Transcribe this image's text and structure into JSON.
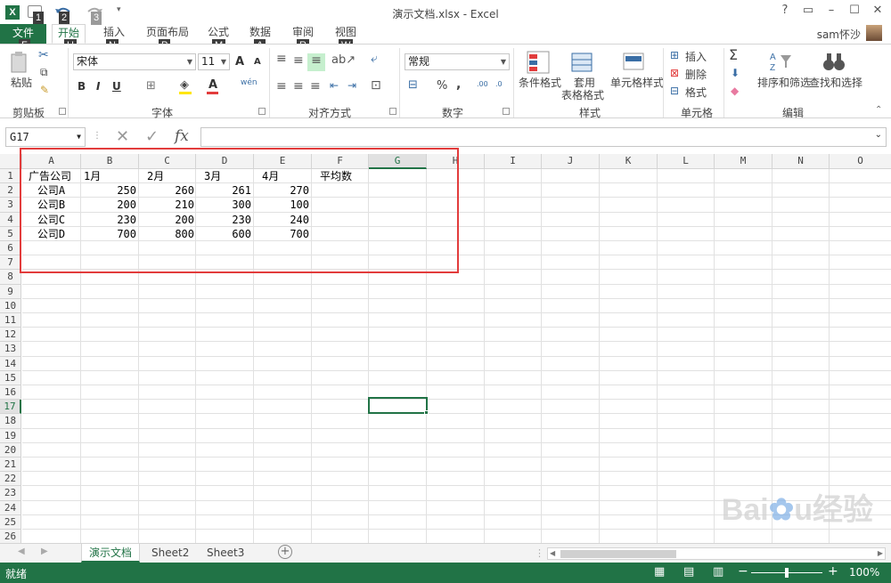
{
  "window": {
    "title": "演示文档.xlsx - Excel",
    "user": "sam怀沙",
    "controls": [
      "?",
      "▭",
      "–",
      "☐",
      "✕"
    ]
  },
  "keytips": {
    "qat": [
      "1",
      "2",
      "3"
    ],
    "tabs": [
      "F",
      "H",
      "N",
      "P",
      "M",
      "A",
      "R",
      "W"
    ]
  },
  "tabs": [
    "文件",
    "开始",
    "插入",
    "页面布局",
    "公式",
    "数据",
    "审阅",
    "视图"
  ],
  "ribbon": {
    "clipboard": {
      "paste": "粘贴",
      "label": "剪贴板"
    },
    "font": {
      "name": "宋体",
      "size": "11",
      "label": "字体",
      "bold": "B",
      "italic": "I",
      "underline": "U",
      "grow": "A",
      "shrink": "A",
      "phonetic": "wén"
    },
    "alignment": {
      "label": "对齐方式"
    },
    "number": {
      "format": "常规",
      "label": "数字",
      "percent": "%",
      "comma": ","
    },
    "styles": {
      "conditional": "条件格式",
      "table": "套用\n表格格式",
      "table_line1": "套用",
      "table_line2": "表格格式",
      "cell_styles": "单元格样式",
      "label": "样式"
    },
    "cells": {
      "insert": "插入",
      "delete": "删除",
      "format": "格式",
      "label": "单元格"
    },
    "editing": {
      "sort": "排序和筛选",
      "find": "查找和选择",
      "label": "编辑"
    }
  },
  "formula_bar": {
    "name_box": "G17",
    "fx": "fx",
    "formula": ""
  },
  "columns": [
    "A",
    "B",
    "C",
    "D",
    "E",
    "F",
    "G",
    "H",
    "I",
    "J",
    "K",
    "L",
    "M",
    "N",
    "O"
  ],
  "selected_column": "G",
  "rows": [
    "1",
    "2",
    "3",
    "4",
    "5",
    "6",
    "7",
    "8",
    "9",
    "10",
    "11",
    "12",
    "13",
    "14",
    "15",
    "16",
    "17",
    "18",
    "19",
    "20",
    "21",
    "22",
    "23",
    "24",
    "25",
    "26"
  ],
  "selected_row": "17",
  "cells": {
    "A1": "广告公司",
    "B1": "1月",
    "C1": "2月",
    "D1": "3月",
    "E1": "4月",
    "F1": "平均数",
    "A2": "公司A",
    "B2": "250",
    "C2": "260",
    "D2": "261",
    "E2": "270",
    "A3": "公司B",
    "B3": "200",
    "C3": "210",
    "D3": "300",
    "E3": "100",
    "A4": "公司C",
    "B4": "230",
    "C4": "200",
    "D4": "230",
    "E4": "240",
    "A5": "公司D",
    "B5": "700",
    "C5": "800",
    "D5": "600",
    "E5": "700"
  },
  "sheets": [
    "演示文档",
    "Sheet2",
    "Sheet3"
  ],
  "active_sheet": "演示文档",
  "status": {
    "ready": "就绪",
    "zoom": "100%"
  },
  "colors": {
    "excel_green": "#217346",
    "highlight_red": "#e23c3c"
  },
  "watermark": "Baidu经验"
}
